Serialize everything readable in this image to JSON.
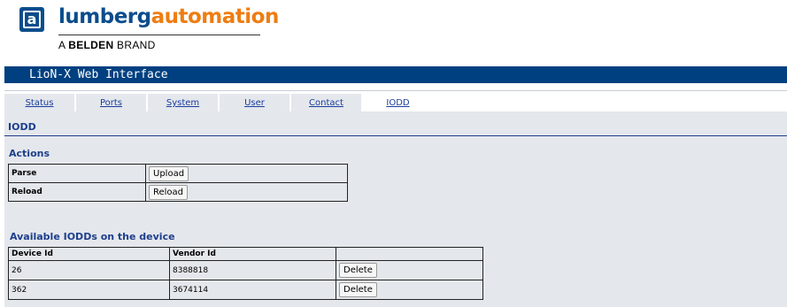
{
  "brand": {
    "name_part1": "lumberg",
    "name_part2": "automation",
    "tagline_prefix": "A ",
    "tagline_bold": "BELDEN",
    "tagline_suffix": " BRAND",
    "logo_glyph": "a",
    "colors": {
      "primary": "#0b4d8c",
      "accent": "#ee7d11"
    }
  },
  "window": {
    "title": "LioN-X Web Interface"
  },
  "tabs": [
    {
      "label": "Status",
      "active": false
    },
    {
      "label": "Ports",
      "active": false
    },
    {
      "label": "System",
      "active": false
    },
    {
      "label": "User",
      "active": false
    },
    {
      "label": "Contact",
      "active": false
    },
    {
      "label": "IODD",
      "active": true
    }
  ],
  "page": {
    "heading": "IODD",
    "actions": {
      "heading": "Actions",
      "rows": [
        {
          "label": "Parse",
          "button": "Upload"
        },
        {
          "label": "Reload",
          "button": "Reload"
        }
      ]
    },
    "iodds": {
      "heading": "Available IODDs on the device",
      "columns": [
        "Device Id",
        "Vendor Id",
        ""
      ],
      "rows": [
        {
          "device_id": "26",
          "vendor_id": "8388818",
          "action": "Delete"
        },
        {
          "device_id": "362",
          "vendor_id": "3674114",
          "action": "Delete"
        }
      ]
    }
  },
  "theme": {
    "titlebar": "#004080",
    "panel": "#e4e7ec",
    "heading": "#1e3f8c",
    "link": "#1a3d9c"
  }
}
